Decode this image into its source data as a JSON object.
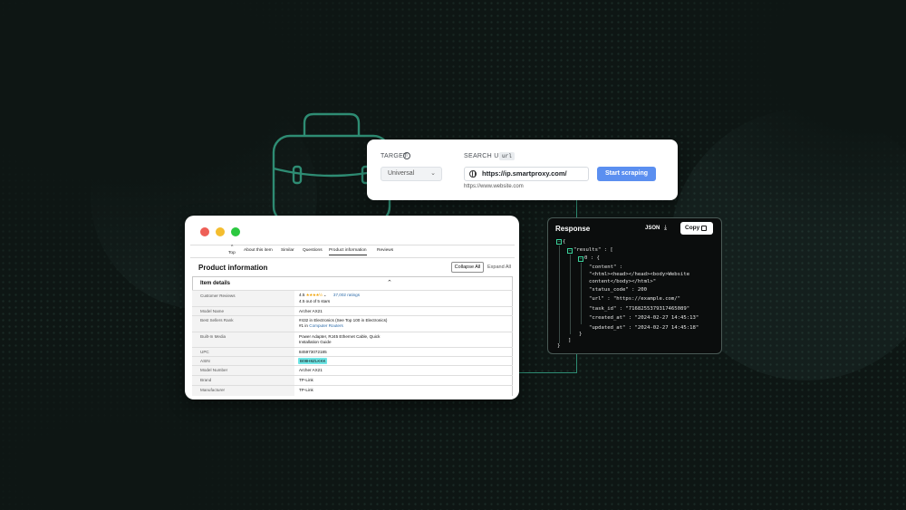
{
  "target_card": {
    "target_label": "TARGET",
    "search_url_label": "SEARCH URL",
    "url_chip": "url",
    "target_value": "Universal",
    "url_value": "https://ip.smartproxy.com/",
    "start_button": "Start scraping",
    "example_url": "https://www.website.com"
  },
  "product_window": {
    "tabs": [
      "About this item",
      "Similar",
      "Questions",
      "Product information",
      "Reviews"
    ],
    "top_label": "Top",
    "title": "Product information",
    "collapse_all": "Collapse All",
    "expand_all": "Expand All",
    "details_heading": "Item details",
    "rows": [
      {
        "key": "Customer Reviews",
        "value_line1_rating": "4.5",
        "value_line1_stars": "★★★★½",
        "value_line1_count": "37,002 ratings",
        "value_line2": "4.5 out of 5 stars"
      },
      {
        "key": "Model Name",
        "value": "Archer AX21"
      },
      {
        "key": "Best Sellers Rank",
        "value_line1": "#432 in Electronics (See Top 100 in Electronics)",
        "value_line2_prefix": "#1 in",
        "value_line2_link": "Computer Routers"
      },
      {
        "key": "Built-In Media",
        "value_line1": "Power Adapter, RJ45 Ethernet Cable, Quick",
        "value_line2": "Installation Guide"
      },
      {
        "key": "UPC",
        "value": "845973072185"
      },
      {
        "key": "ASIN",
        "value": "B08H8ZLKKK"
      },
      {
        "key": "Model Number",
        "value": "Archer AX21"
      },
      {
        "key": "Brand",
        "value": "TP-Link"
      },
      {
        "key": "Manufacturer",
        "value": "TP-Link"
      }
    ]
  },
  "response_panel": {
    "title": "Response",
    "format": "JSON",
    "copy_button": "Copy",
    "lines": [
      "{",
      "\"results\" : [",
      "0 : {",
      "\"content\" :",
      "\"<html><head></head><body>Website",
      "content</body></html>\"",
      "\"status_code\" : 200",
      "\"url\" : \"https://example.com/\"",
      "\"task_id\" : \"7168255379317465089\"",
      "\"created_at\" : \"2024-02-27 14:45:13\"",
      "\"updated_at\" : \"2024-02-27 14:45:18\"",
      "}",
      "]",
      "}"
    ],
    "fold_markers": [
      "−",
      "−",
      "−"
    ]
  },
  "colors": {
    "background": "#0e1614",
    "accent_green": "#2e8c73",
    "button_blue": "#5b8ff0",
    "highlight_cyan": "#6ee6e6",
    "window_dot_red": "#ee5f57",
    "window_dot_yellow": "#f4bd2f",
    "window_dot_green": "#2cc840"
  },
  "icons": [
    "info-icon",
    "chevron-down-icon",
    "globe-icon",
    "chevron-up-icon",
    "download-icon",
    "copy-icon",
    "briefcase-icon"
  ]
}
